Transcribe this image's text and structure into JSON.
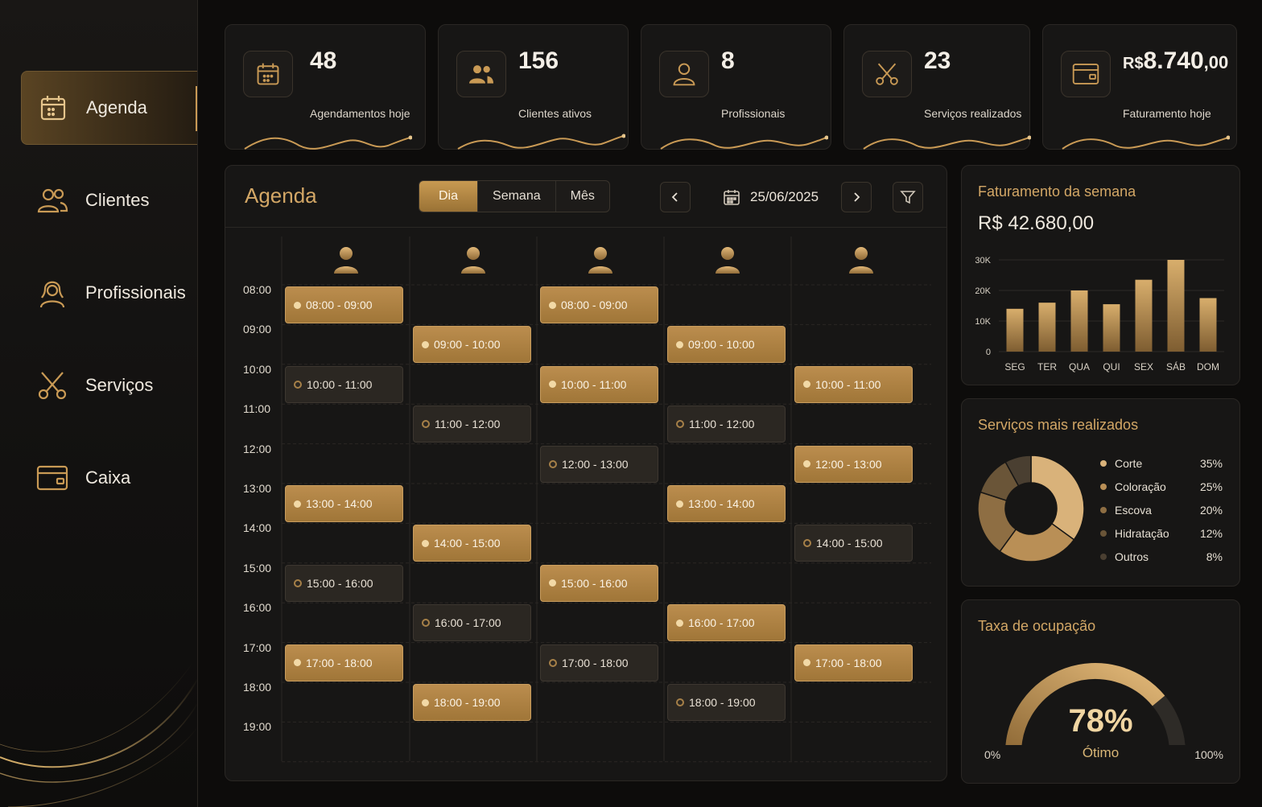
{
  "sidebar": {
    "items": [
      {
        "label": "Agenda",
        "icon": "calendar-icon",
        "active": true
      },
      {
        "label": "Clientes",
        "icon": "users-icon"
      },
      {
        "label": "Profissionais",
        "icon": "professional-icon"
      },
      {
        "label": "Serviços",
        "icon": "scissors-icon"
      },
      {
        "label": "Caixa",
        "icon": "wallet-icon"
      }
    ]
  },
  "stats": [
    {
      "value": "48",
      "label": "Agendamentos hoje",
      "icon": "calendar-icon"
    },
    {
      "value": "156",
      "label": "Clientes ativos",
      "icon": "users-icon"
    },
    {
      "value": "8",
      "label": "Profissionais",
      "icon": "user-icon"
    },
    {
      "value": "23",
      "label": "Serviços realizados",
      "icon": "scissors-icon"
    },
    {
      "currency": "R$",
      "value": "8.740",
      "cents": ",00",
      "label": "Faturamento hoje",
      "icon": "wallet-icon"
    }
  ],
  "agenda": {
    "title": "Agenda",
    "views": [
      "Dia",
      "Semana",
      "Mês"
    ],
    "active_view": "Dia",
    "date": "25/06/2025",
    "times": [
      "08:00",
      "09:00",
      "10:00",
      "11:00",
      "12:00",
      "13:00",
      "14:00",
      "15:00",
      "16:00",
      "17:00",
      "18:00",
      "19:00"
    ],
    "columns": [
      [
        {
          "time": "08:00 - 09:00",
          "style": "gold"
        },
        {
          "time": "10:00 - 11:00",
          "style": "dark"
        },
        {
          "time": "13:00 - 14:00",
          "style": "gold"
        },
        {
          "time": "15:00 - 16:00",
          "style": "dark"
        },
        {
          "time": "17:00 - 18:00",
          "style": "gold"
        }
      ],
      [
        {
          "time": "09:00 - 10:00",
          "style": "gold"
        },
        {
          "time": "11:00 - 12:00",
          "style": "dark"
        },
        {
          "time": "14:00 - 15:00",
          "style": "gold"
        },
        {
          "time": "16:00 - 17:00",
          "style": "dark"
        },
        {
          "time": "18:00 - 19:00",
          "style": "gold"
        }
      ],
      [
        {
          "time": "08:00 - 09:00",
          "style": "gold"
        },
        {
          "time": "10:00 - 11:00",
          "style": "gold"
        },
        {
          "time": "12:00 - 13:00",
          "style": "dark"
        },
        {
          "time": "15:00 - 16:00",
          "style": "gold"
        },
        {
          "time": "17:00 - 18:00",
          "style": "dark"
        }
      ],
      [
        {
          "time": "09:00 - 10:00",
          "style": "gold"
        },
        {
          "time": "11:00 - 12:00",
          "style": "dark"
        },
        {
          "time": "13:00 - 14:00",
          "style": "gold"
        },
        {
          "time": "16:00 - 17:00",
          "style": "gold"
        },
        {
          "time": "18:00 - 19:00",
          "style": "dark"
        }
      ],
      [
        {
          "time": "10:00 - 11:00",
          "style": "gold"
        },
        {
          "time": "12:00 - 13:00",
          "style": "gold"
        },
        {
          "time": "14:00 - 15:00",
          "style": "dark"
        },
        {
          "time": "17:00 - 18:00",
          "style": "gold"
        }
      ]
    ]
  },
  "revenue": {
    "title": "Faturamento da semana",
    "total": "R$ 42.680,00"
  },
  "services": {
    "title": "Serviços mais realizados",
    "items": [
      {
        "name": "Corte",
        "pct": "35%",
        "value": 35,
        "color": "#d9b27a"
      },
      {
        "name": "Coloração",
        "pct": "25%",
        "value": 25,
        "color": "#b98f56"
      },
      {
        "name": "Escova",
        "pct": "20%",
        "value": 20,
        "color": "#8e6e43"
      },
      {
        "name": "Hidratação",
        "pct": "12%",
        "value": 12,
        "color": "#6a5538"
      },
      {
        "name": "Outros",
        "pct": "8%",
        "value": 8,
        "color": "#4a3f31"
      }
    ]
  },
  "occupancy": {
    "title": "Taxa de ocupação",
    "value": "78%",
    "fraction": 0.78,
    "status": "Ótimo",
    "min_label": "0%",
    "max_label": "100%"
  },
  "chart_data": [
    {
      "type": "bar",
      "categories": [
        "SEG",
        "TER",
        "QUA",
        "QUI",
        "SEX",
        "SÁB",
        "DOM"
      ],
      "values": [
        14000,
        16000,
        20000,
        15500,
        23500,
        30000,
        17500
      ],
      "ylim": [
        0,
        30000
      ],
      "yticks": [
        0,
        10000,
        20000,
        30000
      ],
      "ytick_labels": [
        "0",
        "10K",
        "20K",
        "30K"
      ],
      "grid": true
    },
    {
      "type": "pie",
      "categories": [
        "Corte",
        "Coloração",
        "Escova",
        "Hidratação",
        "Outros"
      ],
      "values": [
        35,
        25,
        20,
        12,
        8
      ]
    }
  ],
  "colors": {
    "accent": "#c99a55",
    "gold_light": "#e6c58c",
    "background": "#0d0c0b",
    "panel": "#171615"
  }
}
